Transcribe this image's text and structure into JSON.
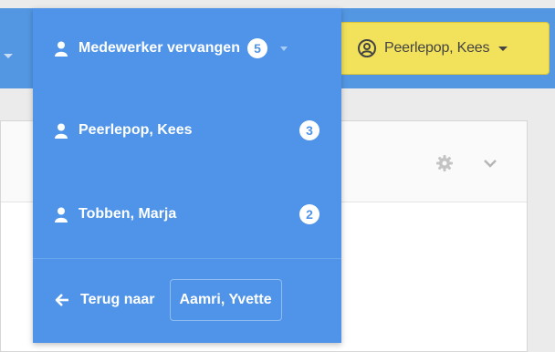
{
  "topbar": {
    "left_caret_icon": "caret-down-icon"
  },
  "user_menu": {
    "label": "Peerlepop, Kees",
    "icon": "user-circle-icon",
    "caret_icon": "caret-down-icon"
  },
  "panel_header": {
    "settings_icon": "gear-icon",
    "collapse_icon": "chevron-down-icon"
  },
  "dropdown": {
    "title": "Medewerker vervangen",
    "count": "5",
    "items": [
      {
        "name": "Peerlepop, Kees",
        "count": "3",
        "icon": "user-icon"
      },
      {
        "name": "Tobben, Marja",
        "count": "2",
        "icon": "user-icon"
      }
    ],
    "back_label": "Terug naar",
    "back_target": "Aamri, Yvette",
    "back_icon": "arrow-left-icon"
  },
  "colors": {
    "accent_blue": "#4f94e8",
    "topbar_blue": "#5397e3",
    "user_button_yellow": "#f2e15a"
  }
}
